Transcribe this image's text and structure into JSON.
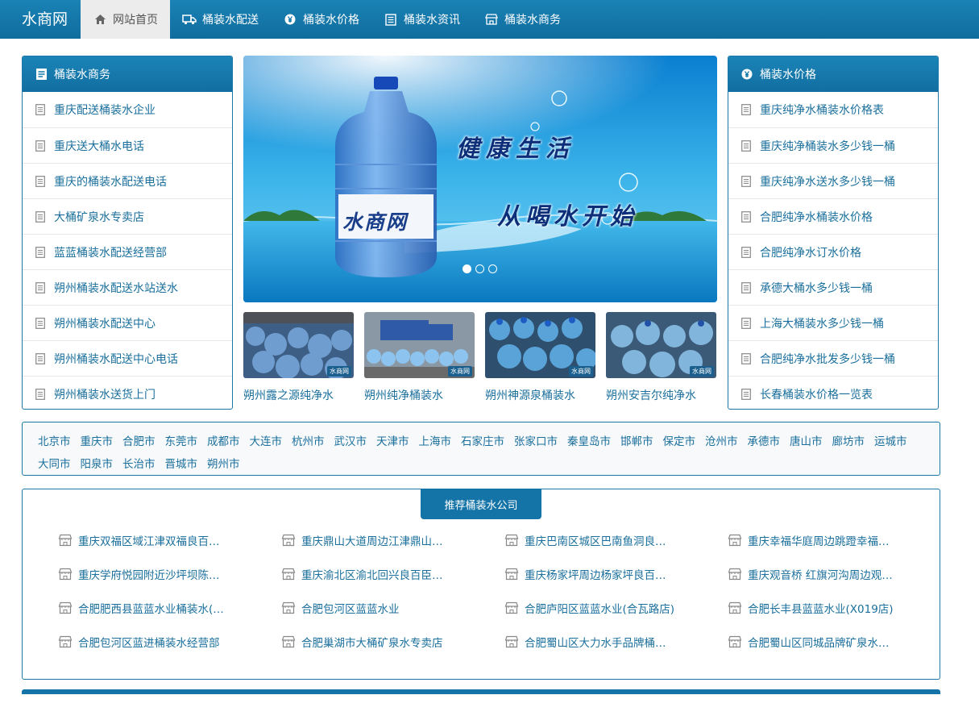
{
  "site": {
    "logo": "水商网"
  },
  "nav": [
    {
      "label": "网站首页",
      "icon": "home-icon",
      "active": true
    },
    {
      "label": "桶装水配送",
      "icon": "truck-icon"
    },
    {
      "label": "桶装水价格",
      "icon": "yen-icon"
    },
    {
      "label": "桶装水资讯",
      "icon": "news-icon"
    },
    {
      "label": "桶装水商务",
      "icon": "shop-icon"
    }
  ],
  "left_panel": {
    "title": "桶装水商务",
    "items": [
      "重庆配送桶装水企业",
      "重庆送大桶水电话",
      "重庆的桶装水配送电话",
      "大桶矿泉水专卖店",
      "蓝蓝桶装水配送经营部",
      "朔州桶装水配送水站送水",
      "朔州桶装水配送中心",
      "朔州桶装水配送中心电话",
      "朔州桶装水送货上门"
    ]
  },
  "right_panel": {
    "title": "桶装水价格",
    "items": [
      "重庆纯净水桶装水价格表",
      "重庆纯净桶装水多少钱一桶",
      "重庆纯净水送水多少钱一桶",
      "合肥纯净水桶装水价格",
      "合肥纯净水订水价格",
      "承德大桶水多少钱一桶",
      "上海大桶装水多少钱一桶",
      "合肥纯净水批发多少钱一桶",
      "长春桶装水价格一览表"
    ]
  },
  "banner": {
    "slogan1": "健康生活",
    "slogan2": "从喝水开始",
    "label": "水商网",
    "slides": 3,
    "active_slide": 1
  },
  "thumbs": [
    {
      "caption": "朔州露之源纯净水",
      "watermark": "水商网"
    },
    {
      "caption": "朔州纯净桶装水",
      "watermark": "水商网"
    },
    {
      "caption": "朔州神源泉桶装水",
      "watermark": "水商网"
    },
    {
      "caption": "朔州安吉尔纯净水",
      "watermark": "水商网"
    }
  ],
  "cities": [
    "北京市",
    "重庆市",
    "合肥市",
    "东莞市",
    "成都市",
    "大连市",
    "杭州市",
    "武汉市",
    "天津市",
    "上海市",
    "石家庄市",
    "张家口市",
    "秦皇岛市",
    "邯郸市",
    "保定市",
    "沧州市",
    "承德市",
    "唐山市",
    "廊坊市",
    "运城市",
    "大同市",
    "阳泉市",
    "长治市",
    "晋城市",
    "朔州市"
  ],
  "recommend": {
    "title": "推荐桶装水公司",
    "items": [
      "重庆双福区域江津双福良百…",
      "重庆鼎山大道周边江津鼎山…",
      "重庆巴南区城区巴南鱼洞良…",
      "重庆幸福华庭周边跳蹬幸福…",
      "重庆学府悦园附近沙坪坝陈…",
      "重庆渝北区渝北回兴良百臣…",
      "重庆杨家坪周边杨家坪良百…",
      "重庆观音桥 红旗河沟周边观…",
      "合肥肥西县蓝蓝水业桶装水(…",
      "合肥包河区蓝蓝水业",
      "合肥庐阳区蓝蓝水业(合瓦路店)",
      "合肥长丰县蓝蓝水业(X019店)",
      "合肥包河区蓝进桶装水经营部",
      "合肥巢湖市大桶矿泉水专卖店",
      "合肥蜀山区大力水手品牌桶…",
      "合肥蜀山区同城品牌矿泉水…"
    ]
  },
  "colors": {
    "primary": "#1474a8",
    "link": "#1a6f9c",
    "border": "#1b77a6"
  }
}
